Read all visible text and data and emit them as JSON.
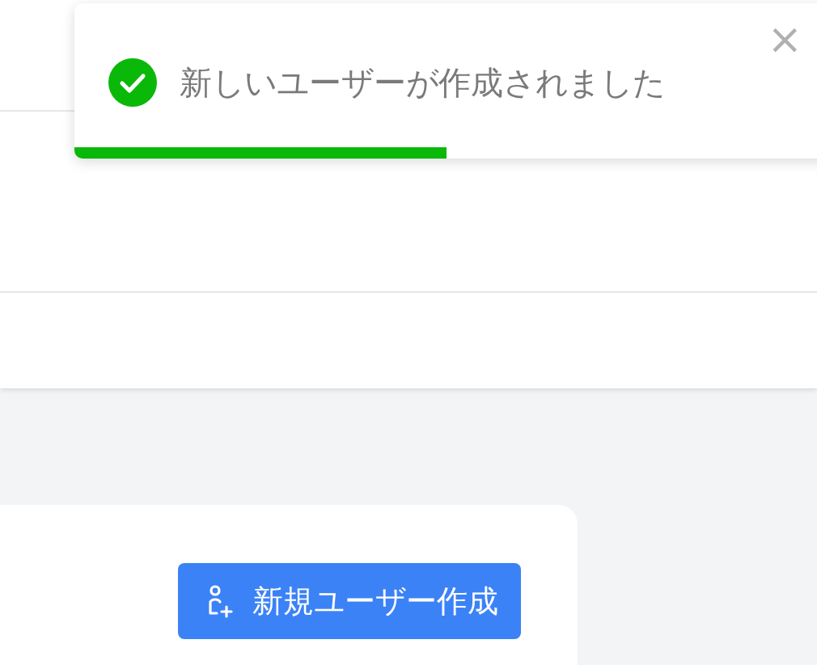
{
  "toast": {
    "kind": "success",
    "message": "新しいユーザーが作成されました",
    "close": "×",
    "level": 0.49
  },
  "create_button": {
    "label": "新規ユーザー作成"
  }
}
